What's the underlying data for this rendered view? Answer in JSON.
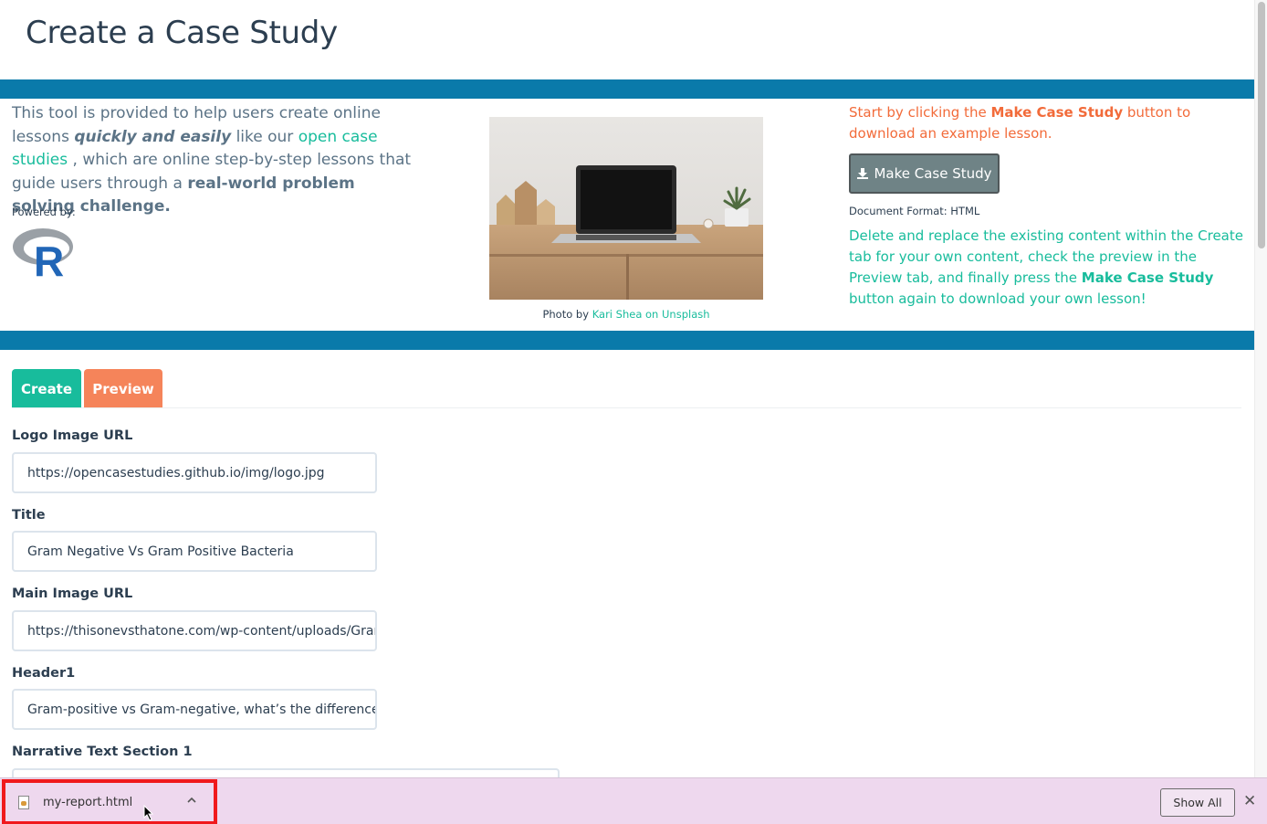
{
  "header": {
    "title": "Create a Case Study"
  },
  "intro": {
    "part1": "This tool is provided to help users create online lessons ",
    "emphasis": "quickly and easily",
    "part2": " like our ",
    "link": "open case studies",
    "part3": " , which are online step-by-step lessons that guide users through a ",
    "bold": "real-world problem solving challenge."
  },
  "powered_by": {
    "label": "Powered by:",
    "logo": "r-logo"
  },
  "photo": {
    "caption_prefix": "Photo by ",
    "caption_link": "Kari Shea on Unsplash"
  },
  "instructions": {
    "start_part1": "Start by clicking the ",
    "start_bold": "Make Case Study",
    "start_part2": " button to download an example lesson.",
    "button_label": "Make Case Study",
    "button_icon": "download-icon",
    "doc_format": "Document Format: HTML",
    "delete_part1": "Delete and replace the existing content within the Create tab for your own content, check the preview in the Preview tab, and finally press the ",
    "delete_bold": "Make Case Study",
    "delete_part2": " button again to download your own lesson!"
  },
  "tabs": [
    {
      "label": "Create",
      "color": "#18bc9c",
      "active": true
    },
    {
      "label": "Preview",
      "color": "#f5845a",
      "active": false
    }
  ],
  "form": {
    "fields": [
      {
        "label": "Logo Image URL",
        "value": "https://opencasestudies.github.io/img/logo.jpg"
      },
      {
        "label": "Title",
        "value": "Gram Negative Vs Gram Positive Bacteria"
      },
      {
        "label": "Main Image URL",
        "value": "https://thisonevsthatone.com/wp-content/uploads/Gram"
      },
      {
        "label": "Header1",
        "value": "Gram-positive vs Gram-negative, what’s the difference??"
      },
      {
        "label": "Narrative Text Section 1",
        "value": ""
      }
    ]
  },
  "download_bar": {
    "file_name": "my-report.html",
    "show_all": "Show All",
    "close": "✕"
  },
  "colors": {
    "band": "#0a7aaa",
    "accent_green": "#18bc9c",
    "accent_orange": "#f26b3a",
    "highlight_box": "#f0191c"
  }
}
